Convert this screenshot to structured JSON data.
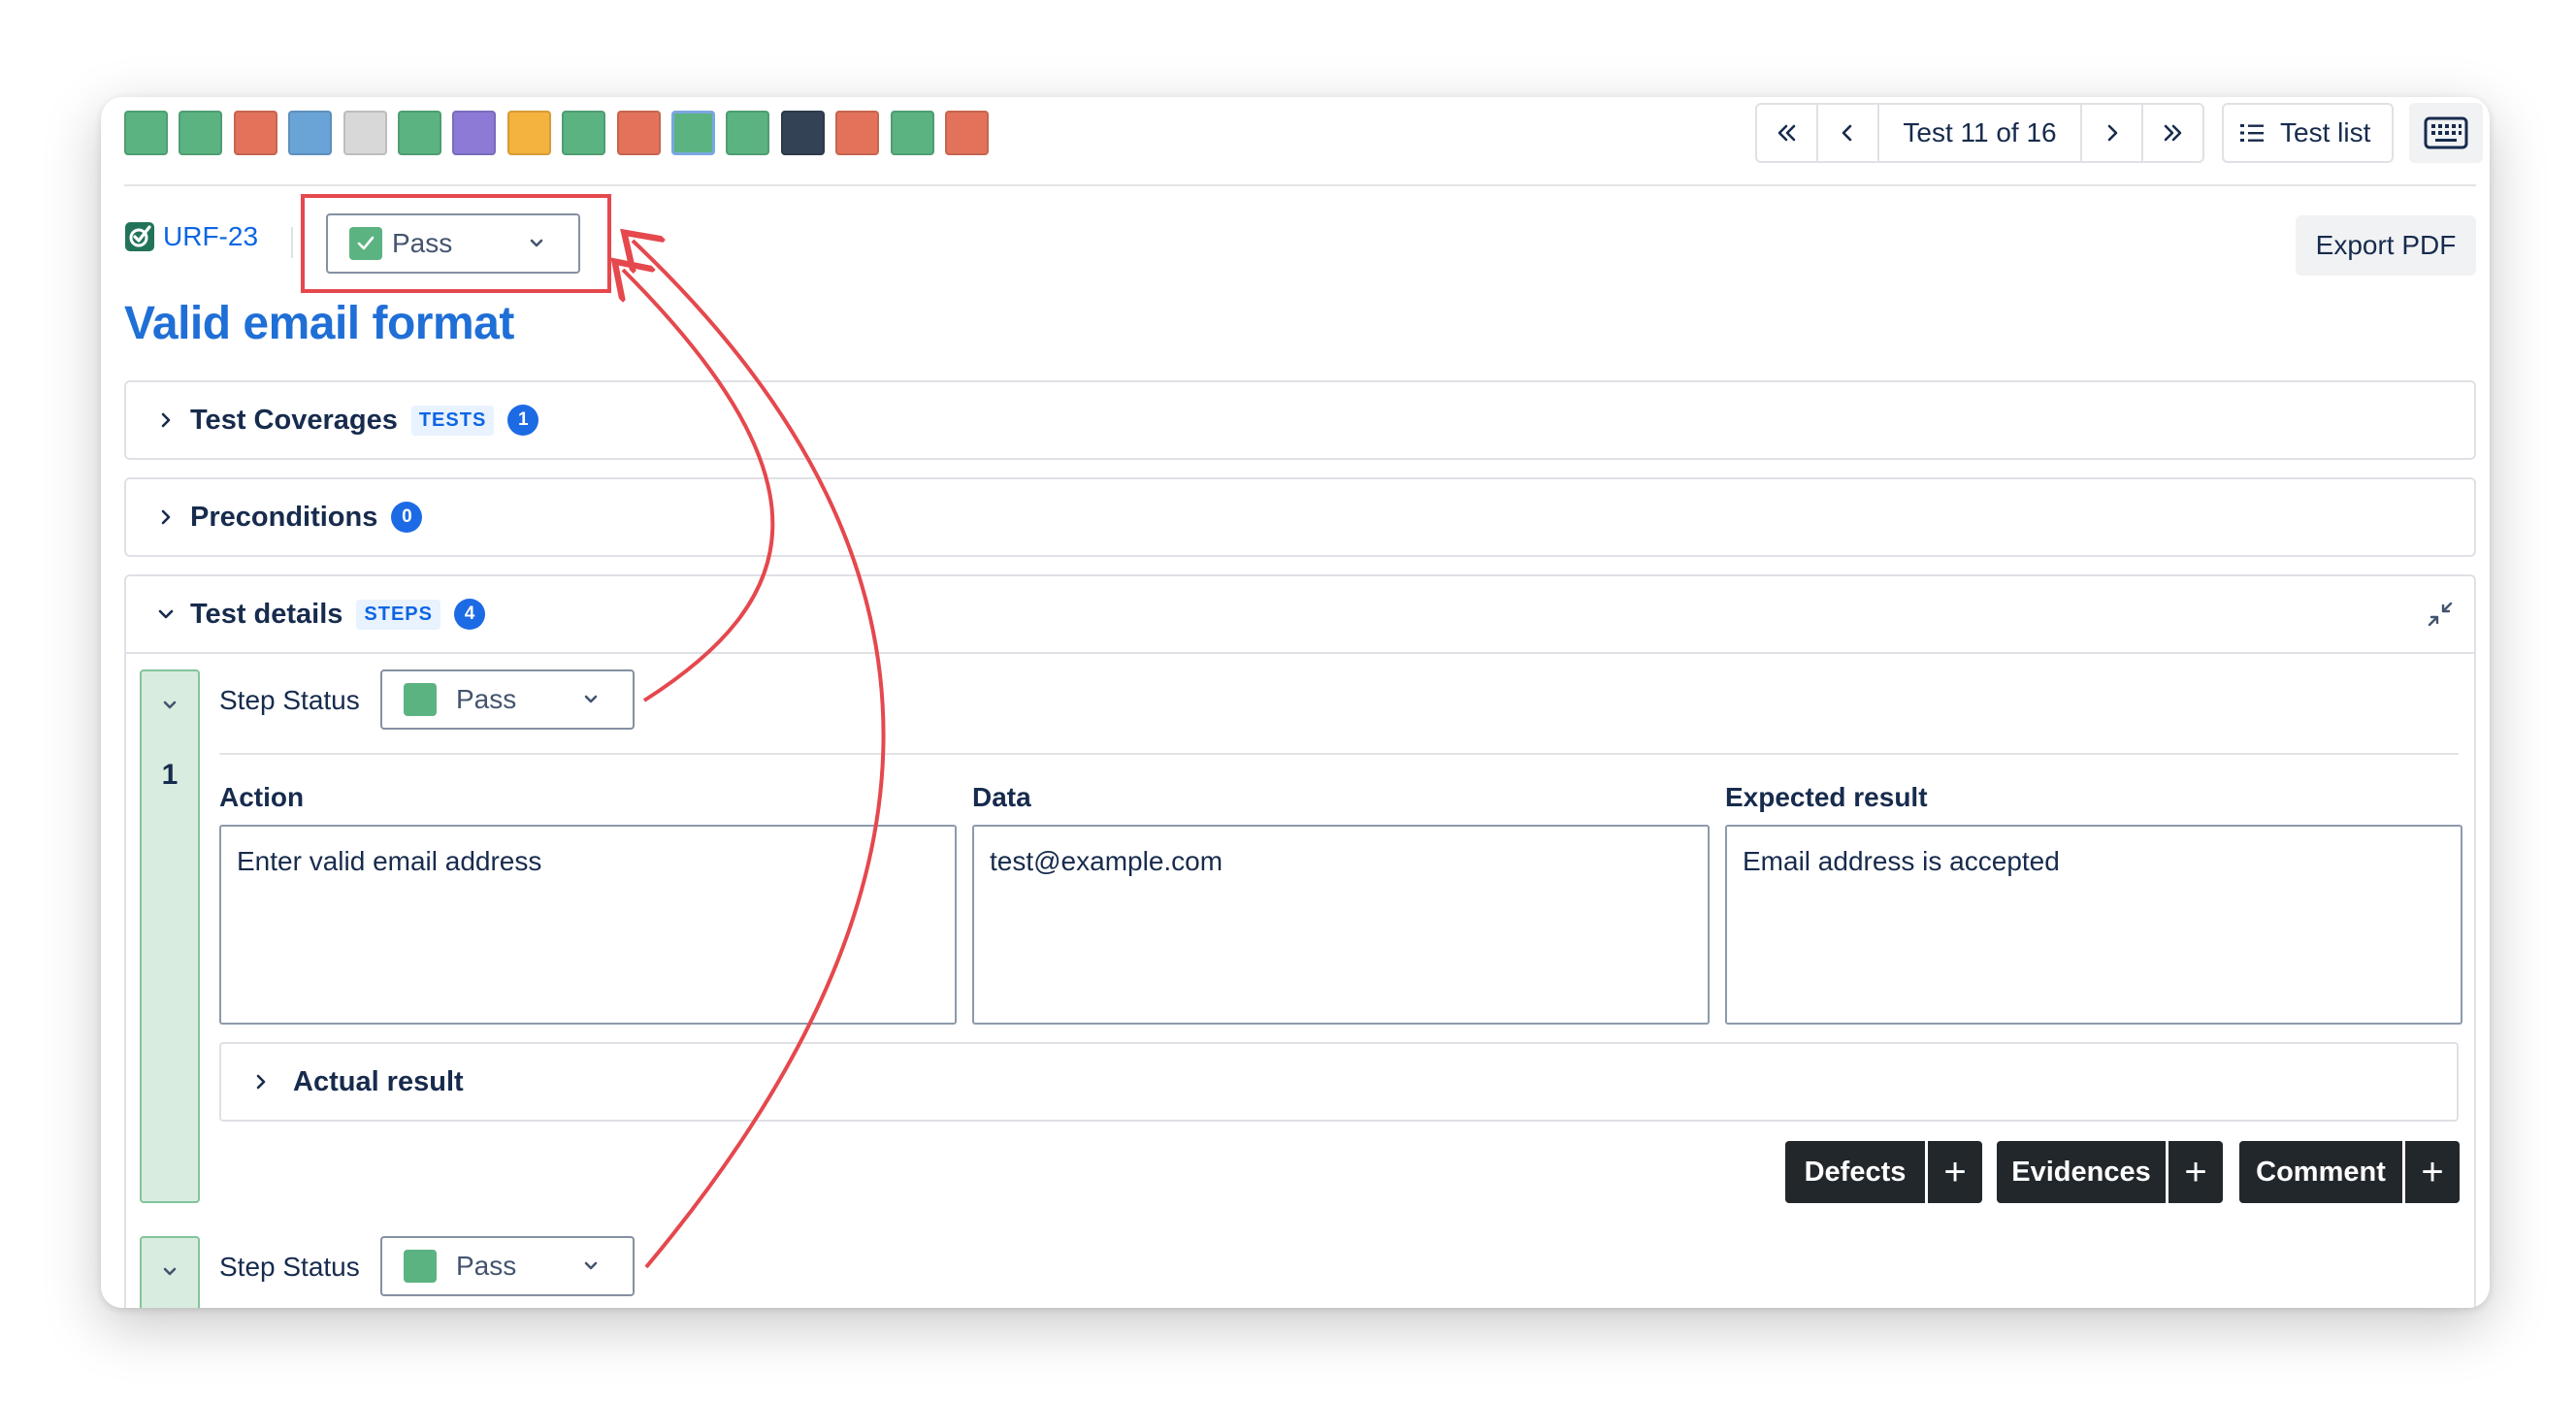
{
  "status_strip": [
    {
      "color": "#5bb381",
      "label": "pass"
    },
    {
      "color": "#5bb381",
      "label": "pass"
    },
    {
      "color": "#e2735a",
      "label": "fail"
    },
    {
      "color": "#6aa3d5",
      "label": "executing"
    },
    {
      "color": "#d8d8d8",
      "label": "todo"
    },
    {
      "color": "#5bb381",
      "label": "pass"
    },
    {
      "color": "#8c7ad6",
      "label": "blocked"
    },
    {
      "color": "#f4b23e",
      "label": "aborted"
    },
    {
      "color": "#5bb381",
      "label": "pass"
    },
    {
      "color": "#e2735a",
      "label": "fail"
    },
    {
      "color": "#5bb381",
      "label": "pass",
      "current": true
    },
    {
      "color": "#5bb381",
      "label": "pass"
    },
    {
      "color": "#344256",
      "label": "other"
    },
    {
      "color": "#e2735a",
      "label": "fail"
    },
    {
      "color": "#5bb381",
      "label": "pass"
    },
    {
      "color": "#e2735a",
      "label": "fail"
    }
  ],
  "nav": {
    "position_label": "Test 11 of 16"
  },
  "toolbar": {
    "test_list_label": "Test list",
    "export_label": "Export PDF"
  },
  "issue": {
    "key": "URF-23",
    "status": "Pass",
    "title": "Valid email format"
  },
  "sections": {
    "coverages": {
      "title": "Test Coverages",
      "lozenge": "TESTS",
      "count": "1"
    },
    "preconditions": {
      "title": "Preconditions",
      "count": "0"
    },
    "details": {
      "title": "Test details",
      "lozenge": "STEPS",
      "count": "4"
    }
  },
  "steps": [
    {
      "number": "1",
      "status_label": "Step Status",
      "status": "Pass",
      "headers": {
        "action": "Action",
        "data": "Data",
        "expected": "Expected result"
      },
      "action": "Enter valid email address",
      "data": "test@example.com",
      "expected": "Email address is accepted",
      "actual_label": "Actual result",
      "buttons": {
        "defects": "Defects",
        "evidences": "Evidences",
        "comment": "Comment"
      }
    },
    {
      "status_label": "Step Status",
      "status": "Pass"
    }
  ],
  "annotation_color": "#e5484d"
}
